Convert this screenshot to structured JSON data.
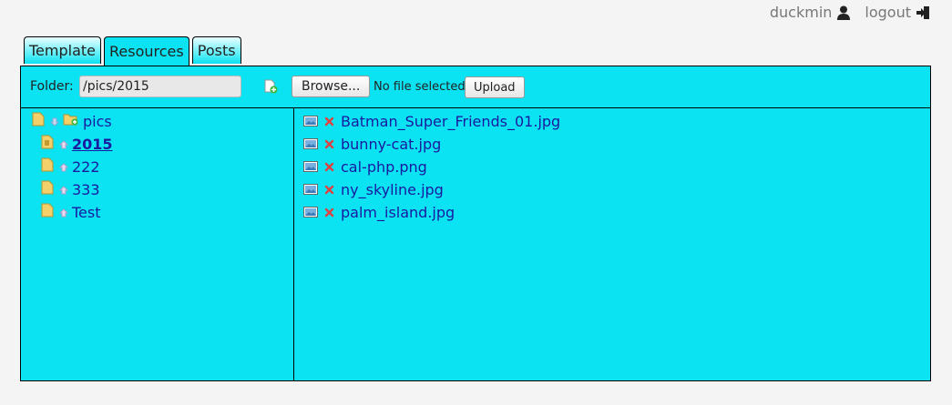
{
  "header": {
    "username": "duckmin",
    "logout_label": "logout"
  },
  "tabs": [
    {
      "label": "Template",
      "active": false
    },
    {
      "label": "Resources",
      "active": true
    },
    {
      "label": "Posts",
      "active": false
    }
  ],
  "toolbar": {
    "folder_label": "Folder:",
    "folder_value": "/pics/2015",
    "browse_label": "Browse...",
    "file_status": "No file selected.",
    "upload_label": "Upload"
  },
  "tree": {
    "root": "pics",
    "folders": [
      {
        "name": "2015",
        "current": true
      },
      {
        "name": "222",
        "current": false
      },
      {
        "name": "333",
        "current": false
      },
      {
        "name": "Test",
        "current": false
      }
    ]
  },
  "files": [
    "Batman_Super_Friends_01.jpg",
    "bunny-cat.jpg",
    "cal-php.png",
    "ny_skyline.jpg",
    "palm_island.jpg"
  ],
  "colors": {
    "panel_bg": "#0be3f3",
    "link": "#1a1aa0",
    "delete_icon": "#e04040"
  }
}
